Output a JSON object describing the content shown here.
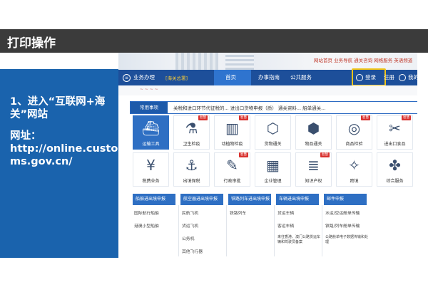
{
  "slide": {
    "title": "打印操作",
    "step_title": "1、进入“互联网+海关”网站",
    "url_label": "网址：",
    "url_value": "http://online.customs.gov.cn/"
  },
  "site": {
    "top_links": "网站首页  业务导航  通关咨询  网络服务  英语频道",
    "nav": {
      "business": "业务办理",
      "tag": "[海关总署]",
      "home": "首页",
      "guide": "办事指南",
      "public": "公共服务",
      "login": "登录",
      "register": "注册",
      "mine": "我的"
    },
    "banner_text": "~ ~ ~ ~",
    "common": {
      "label": "常用事项",
      "links": "关税和进口环节代征税的...     进出口货物申报（质）     通关资料...     船单通关..."
    },
    "tiles": [
      {
        "label": "运输工具",
        "icon": "ship-icon",
        "glyph": "⛴",
        "active": true,
        "badge": ""
      },
      {
        "label": "卫生检疫",
        "icon": "microscope-icon",
        "glyph": "🔬",
        "active": false,
        "badge": "智慧"
      },
      {
        "label": "动植物检疫",
        "icon": "plant-quarantine-icon",
        "glyph": "▥",
        "active": false,
        "badge": "智慧"
      },
      {
        "label": "货物通关",
        "icon": "cargo-box-icon",
        "glyph": "⬡",
        "active": false,
        "badge": ""
      },
      {
        "label": "物品通关",
        "icon": "package-icon",
        "glyph": "⬢",
        "active": false,
        "badge": ""
      },
      {
        "label": "商品检验",
        "icon": "inspection-icon",
        "glyph": "◎",
        "active": false,
        "badge": "智慧"
      },
      {
        "label": "进出口食品",
        "icon": "food-icon",
        "glyph": "✂",
        "active": false,
        "badge": "智慧"
      },
      {
        "label": "税费业务",
        "icon": "tax-icon",
        "glyph": "¥",
        "active": false,
        "badge": ""
      },
      {
        "label": "出境保税",
        "icon": "anchor-icon",
        "glyph": "⚓",
        "active": false,
        "badge": ""
      },
      {
        "label": "行政审批",
        "icon": "approval-icon",
        "glyph": "✎",
        "active": false,
        "badge": "智慧"
      },
      {
        "label": "企业管理",
        "icon": "building-icon",
        "glyph": "▦",
        "active": false,
        "badge": ""
      },
      {
        "label": "知识产权",
        "icon": "books-icon",
        "glyph": "≣",
        "active": false,
        "badge": "智慧"
      },
      {
        "label": "跨境",
        "icon": "pin-icon",
        "glyph": "✧",
        "active": false,
        "badge": ""
      },
      {
        "label": "综合服务",
        "icon": "clover-icon",
        "glyph": "✤",
        "active": false,
        "badge": ""
      }
    ],
    "columns": [
      {
        "head": "船舶进出境申报",
        "items": [
          "国际航行船舶",
          "港澳小型船舶"
        ]
      },
      {
        "head": "航空器进出境申报",
        "items": [
          "民航飞机",
          "货运飞机",
          "公务机",
          "其他飞行器"
        ]
      },
      {
        "head": "铁路列车进出境申报",
        "items": [
          "铁路列车"
        ]
      },
      {
        "head": "车辆进出境申报",
        "items": [
          "货运车辆",
          "客运车辆",
          "来往香港、澳门公路货运车辆和驾驶员备案"
        ]
      },
      {
        "head": "邮件申报",
        "items": [
          "水运/空运舱单传输",
          "铁路/列车舱单传输",
          "公路舱单电子数据传输和处理"
        ]
      }
    ]
  }
}
